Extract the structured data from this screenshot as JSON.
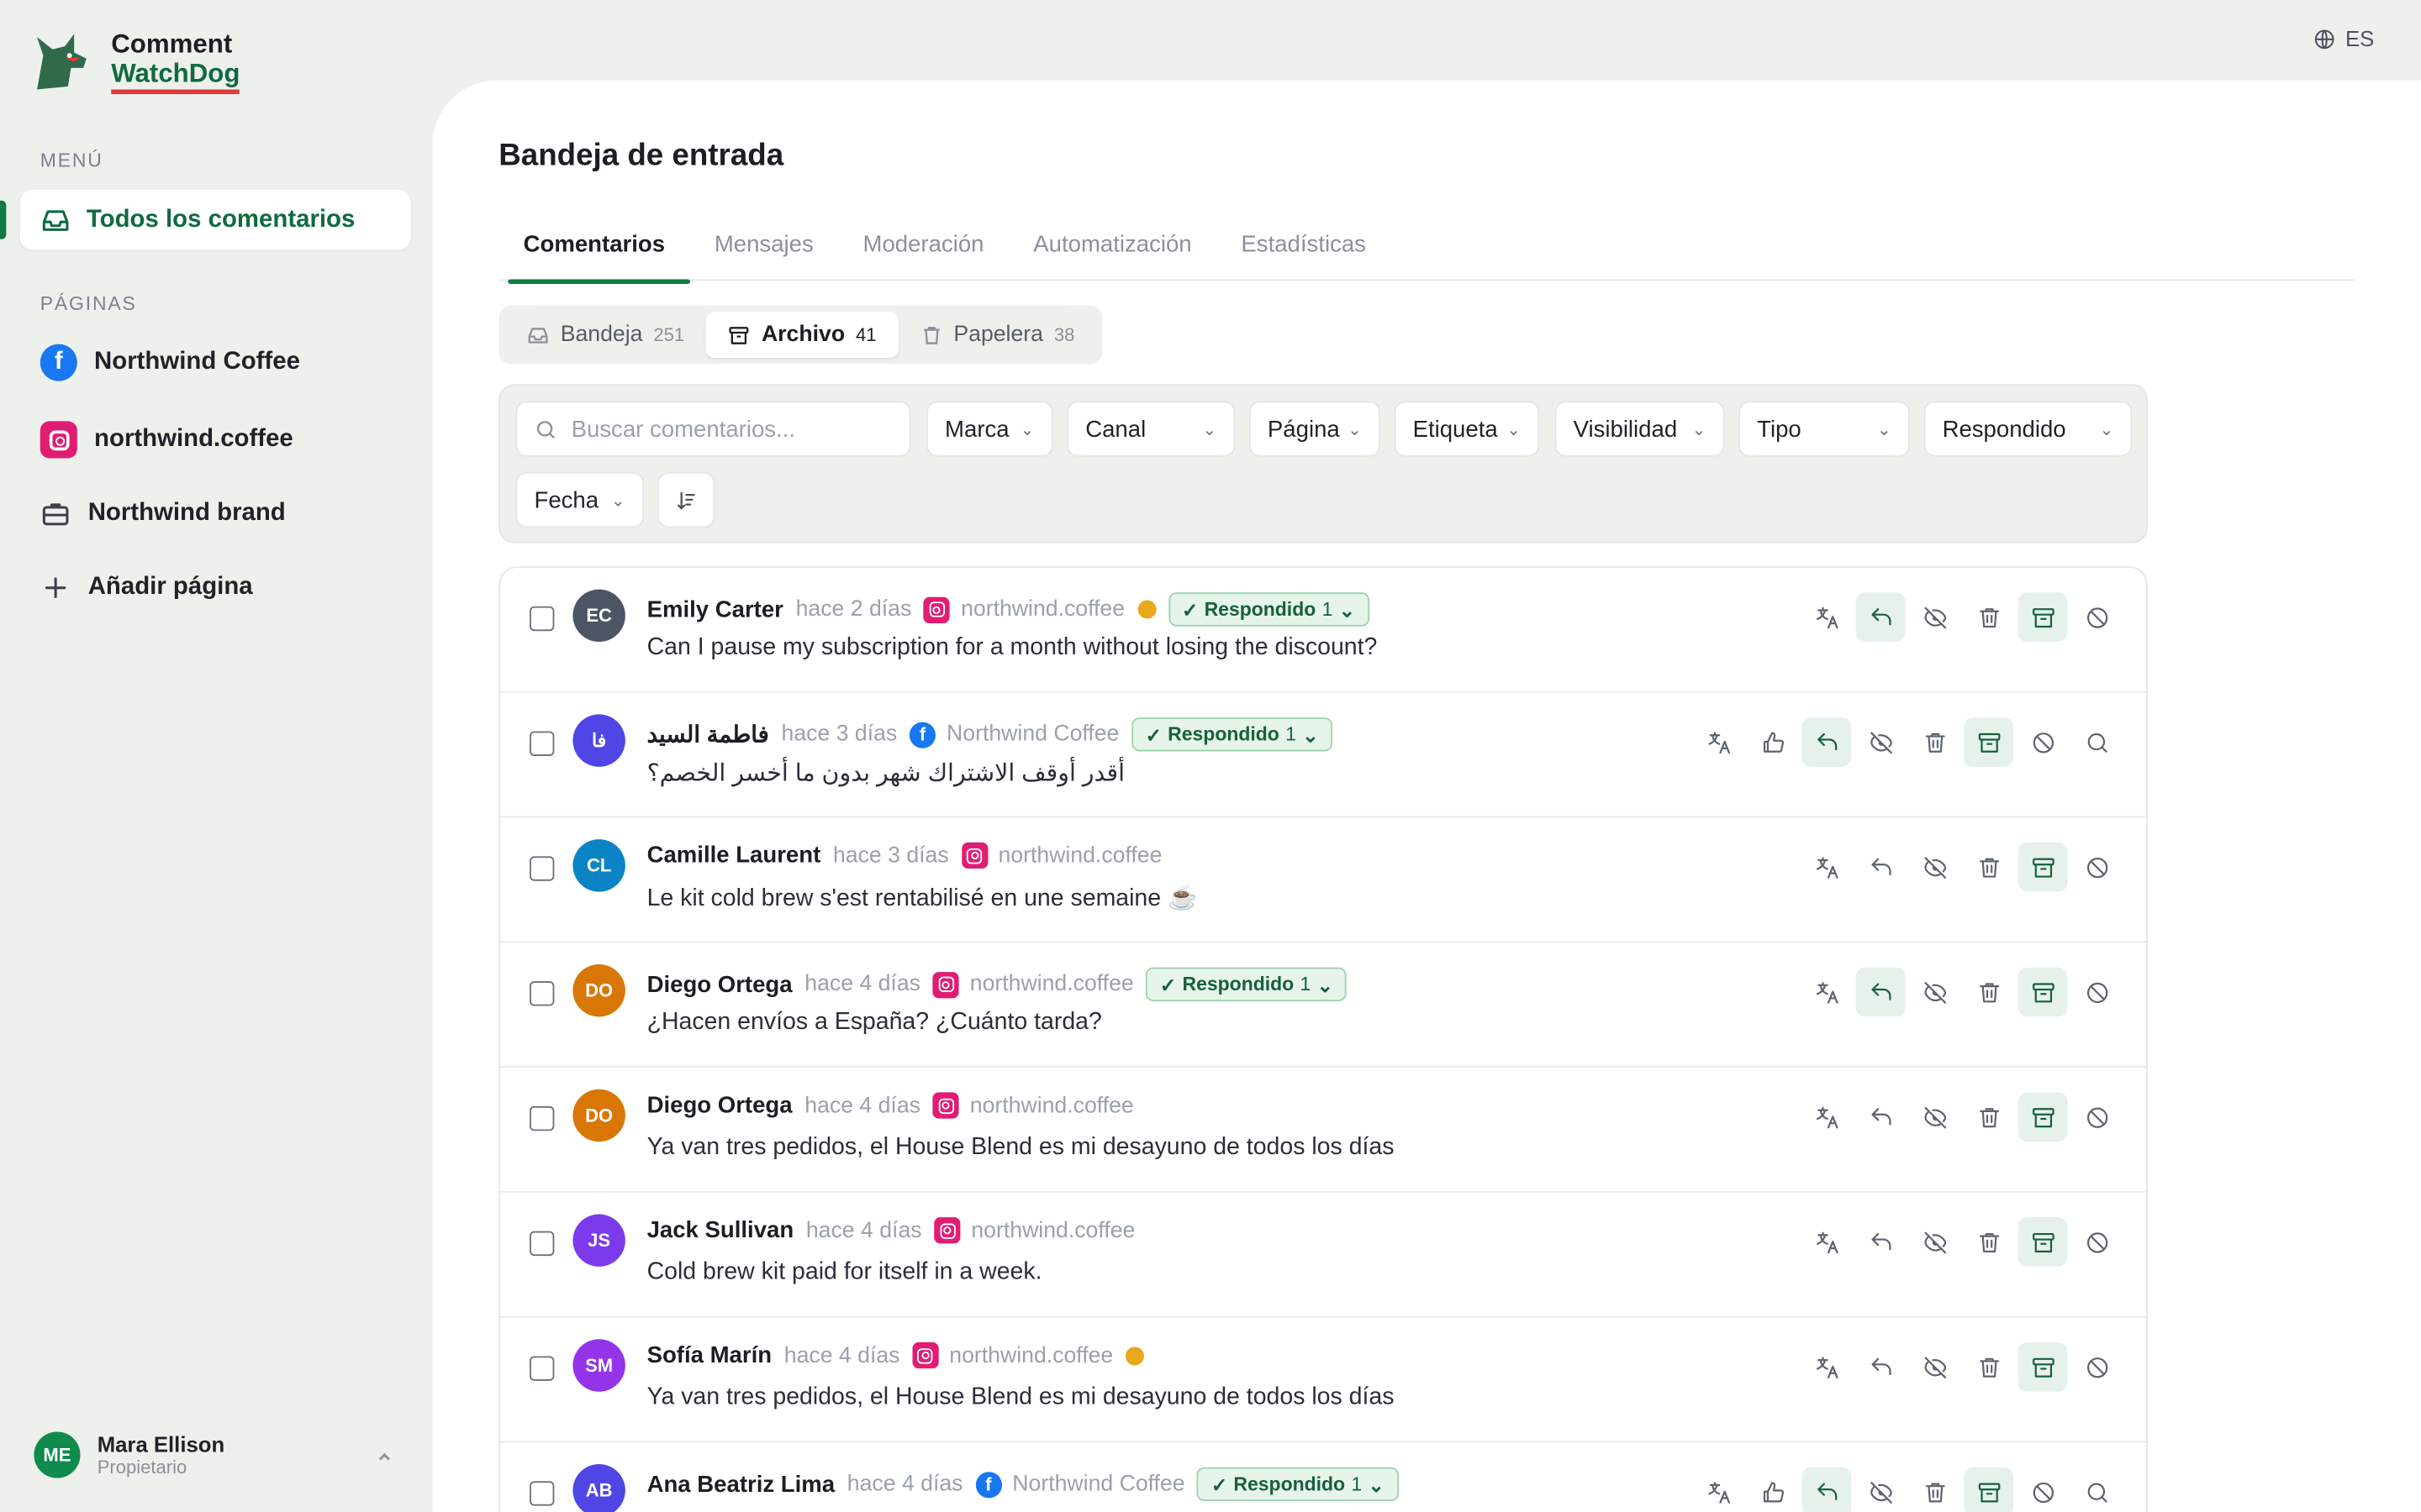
{
  "app": {
    "name_line1": "Comment",
    "name_line2": "WatchDog",
    "language": "ES"
  },
  "sidebar": {
    "menu_label": "MENÚ",
    "active_item": "Todos los comentarios",
    "pages_label": "PÁGINAS",
    "pages": [
      {
        "label": "Northwind Coffee",
        "icon": "facebook-icon"
      },
      {
        "label": "northwind.coffee",
        "icon": "instagram-icon"
      },
      {
        "label": "Northwind brand",
        "icon": "briefcase-icon"
      },
      {
        "label": "Añadir página",
        "icon": "plus-icon"
      }
    ],
    "user": {
      "initials": "ME",
      "name": "Mara Ellison",
      "role": "Propietario"
    }
  },
  "main": {
    "title": "Bandeja de entrada",
    "tabs": [
      "Comentarios",
      "Mensajes",
      "Moderación",
      "Automatización",
      "Estadísticas"
    ],
    "segments": [
      {
        "label": "Bandeja",
        "count": "251"
      },
      {
        "label": "Archivo",
        "count": "41"
      },
      {
        "label": "Papelera",
        "count": "38"
      }
    ],
    "filters": {
      "search_placeholder": "Buscar comentarios...",
      "dropdowns": [
        "Marca",
        "Canal",
        "Página",
        "Etiqueta",
        "Visibilidad",
        "Tipo",
        "Respondido",
        "Fecha"
      ]
    }
  },
  "comments": [
    {
      "initials": "EC",
      "color": "#4b5563",
      "author": "Emily Carter",
      "time": "hace 2 días",
      "source": "northwind.coffee",
      "channel": "instagram",
      "coin": true,
      "badge": "Respondido",
      "badge_count": "1",
      "text": "Can I pause my subscription for a month without losing the discount?"
    },
    {
      "initials": "فا",
      "color": "#4f46e5",
      "author": "فاطمة السيد",
      "time": "hace 3 días",
      "source": "Northwind Coffee",
      "channel": "facebook",
      "coin": false,
      "badge": "Respondido",
      "badge_count": "1",
      "text": "أقدر أوقف الاشتراك شهر بدون ما أخسر الخصم؟"
    },
    {
      "initials": "CL",
      "color": "#0b84c6",
      "author": "Camille Laurent",
      "time": "hace 3 días",
      "source": "northwind.coffee",
      "channel": "instagram",
      "coin": false,
      "badge": "",
      "badge_count": "",
      "text": "Le kit cold brew s'est rentabilisé en une semaine ☕"
    },
    {
      "initials": "DO",
      "color": "#d97706",
      "author": "Diego Ortega",
      "time": "hace 4 días",
      "source": "northwind.coffee",
      "channel": "instagram",
      "coin": false,
      "badge": "Respondido",
      "badge_count": "1",
      "text": "¿Hacen envíos a España? ¿Cuánto tarda?"
    },
    {
      "initials": "DO",
      "color": "#d97706",
      "author": "Diego Ortega",
      "time": "hace 4 días",
      "source": "northwind.coffee",
      "channel": "instagram",
      "coin": false,
      "badge": "",
      "badge_count": "",
      "text": "Ya van tres pedidos, el House Blend es mi desayuno de todos los días"
    },
    {
      "initials": "JS",
      "color": "#7c3aed",
      "author": "Jack Sullivan",
      "time": "hace 4 días",
      "source": "northwind.coffee",
      "channel": "instagram",
      "coin": false,
      "badge": "",
      "badge_count": "",
      "text": "Cold brew kit paid for itself in a week."
    },
    {
      "initials": "SM",
      "color": "#9333ea",
      "author": "Sofía Marín",
      "time": "hace 4 días",
      "source": "northwind.coffee",
      "channel": "instagram",
      "coin": true,
      "badge": "",
      "badge_count": "",
      "text": "Ya van tres pedidos, el House Blend es mi desayuno de todos los días"
    },
    {
      "initials": "AB",
      "color": "#4f46e5",
      "author": "Ana Beatriz Lima",
      "time": "hace 4 días",
      "source": "Northwind Coffee",
      "channel": "facebook",
      "coin": false,
      "badge": "Respondido",
      "badge_count": "1",
      "text": ""
    }
  ]
}
